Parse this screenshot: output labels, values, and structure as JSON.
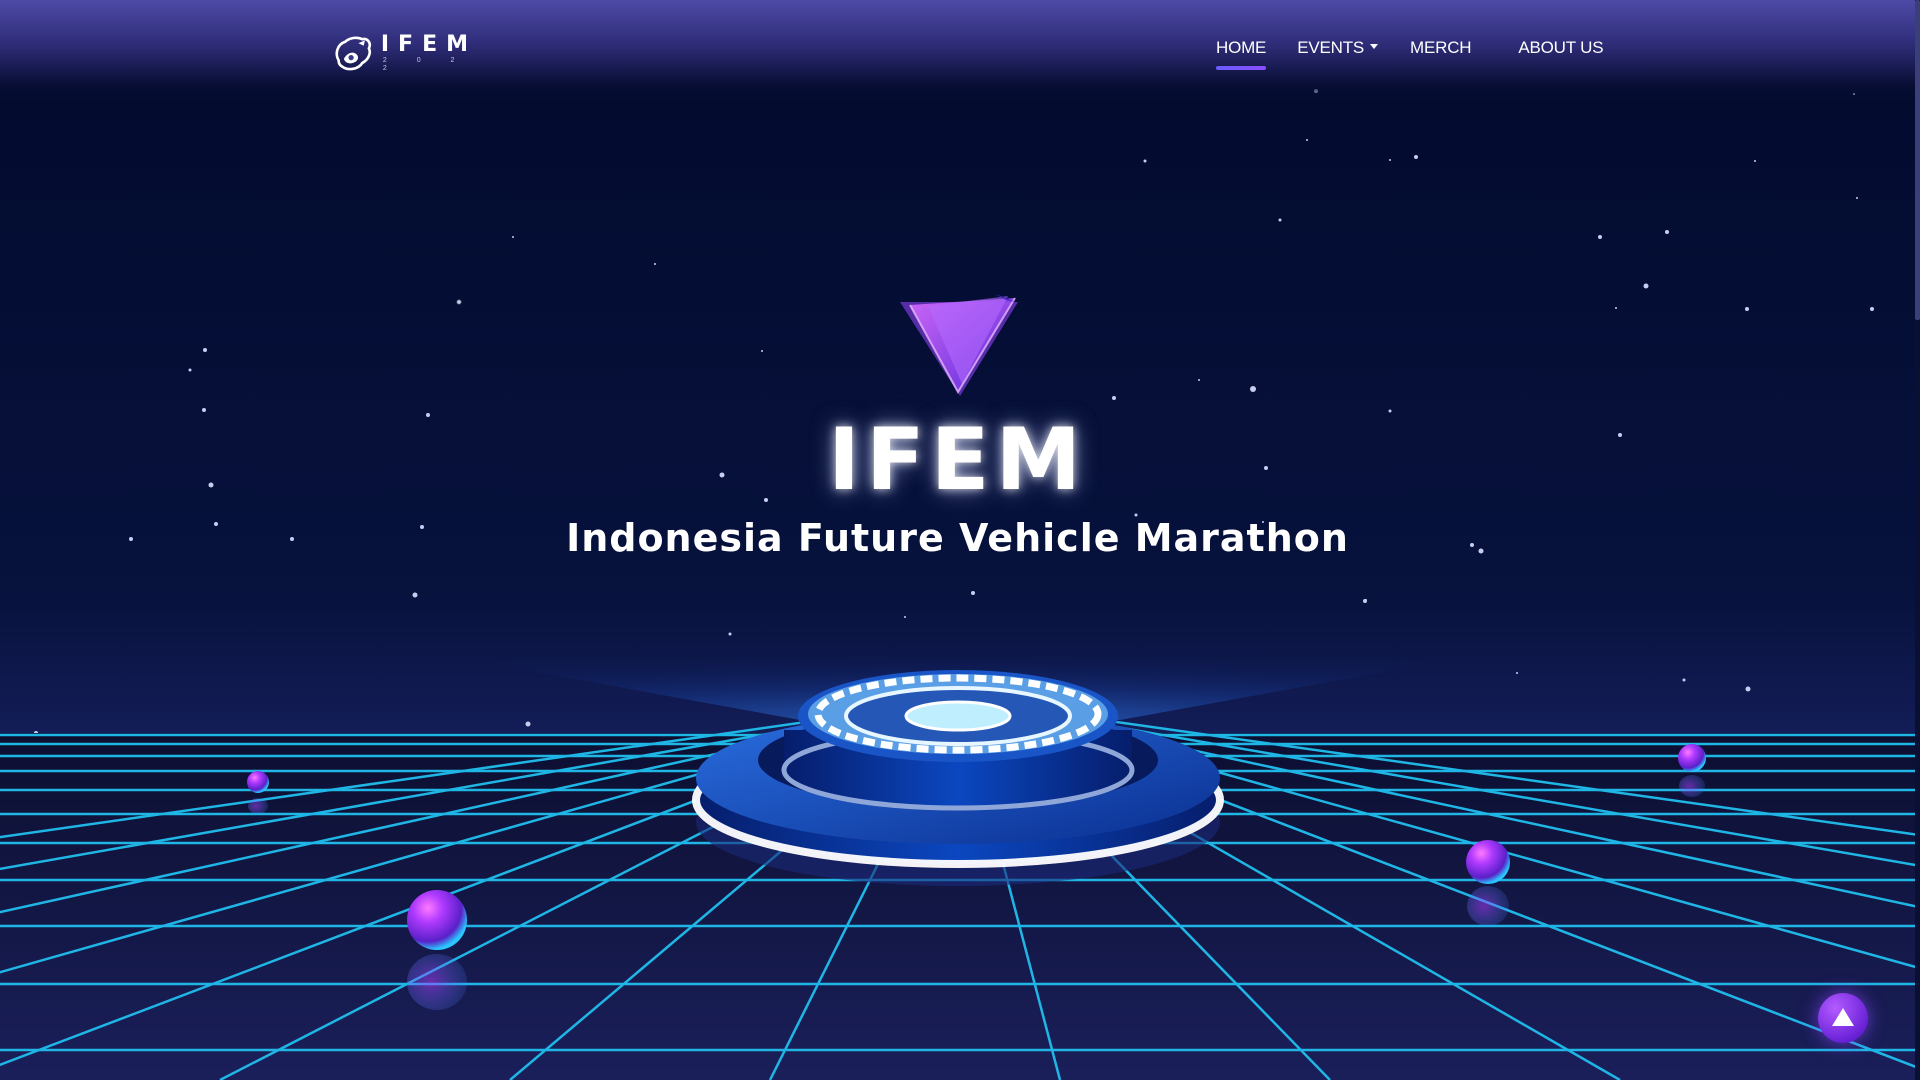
{
  "header": {
    "logo": {
      "wordmark": "IFEM",
      "year": "2 0 2 2",
      "icon": "ifem-logo-icon"
    },
    "nav": [
      {
        "label": "HOME",
        "active": true
      },
      {
        "label": "EVENTS",
        "has_dropdown": true,
        "dropdown_icon": "caret-down-icon"
      },
      {
        "label": "MERCH"
      },
      {
        "label": "ABOUT US"
      }
    ]
  },
  "hero": {
    "title": "IFEM",
    "subtitle": "Indonesia Future Vehicle Marathon",
    "emblem_icon": "triangle-emblem-icon"
  },
  "scroll_to_top": {
    "icon": "arrow-up-triangle-icon"
  },
  "colors": {
    "background": "#020a2c",
    "grid": "#1fb6e6",
    "accent_purple": "#8a3dff",
    "nav_underline": "#6a5cff",
    "podium_blue": "#0a3fa8"
  }
}
